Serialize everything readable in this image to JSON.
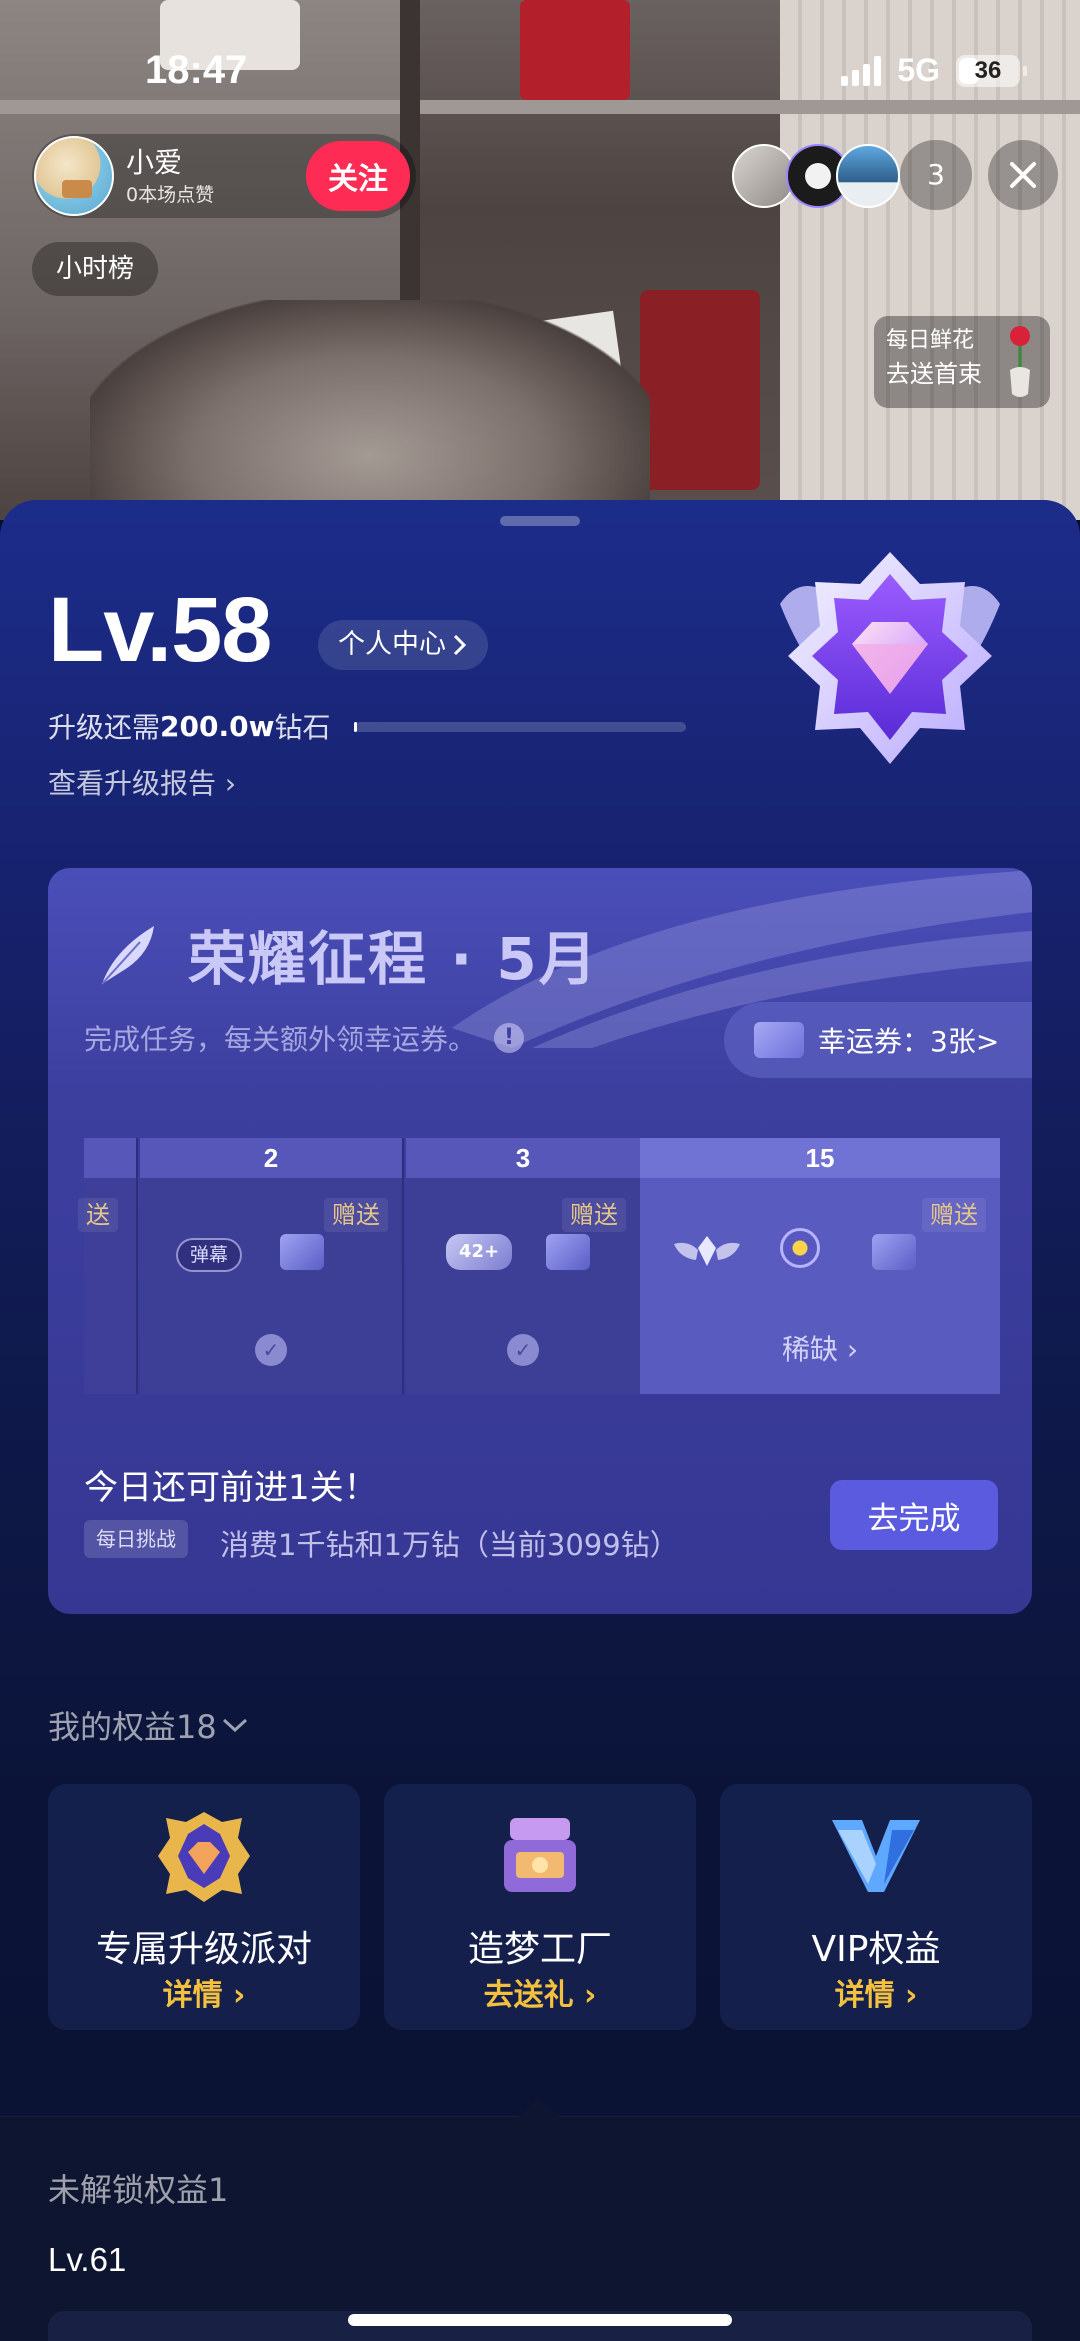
{
  "status": {
    "time": "18:47",
    "network": "5G",
    "battery": "36",
    "battery_level": 0.36
  },
  "host": {
    "name": "小爱",
    "likes": "0本场点赞",
    "follow_label": "关注"
  },
  "hour_rank": "小时榜",
  "viewer_count": "3",
  "flower": {
    "line1": "每日鲜花",
    "line2": "去送首束"
  },
  "level": {
    "label": "Lv.58",
    "personal_center": "个人中心",
    "upgrade_prefix": "升级还需",
    "upgrade_amount": "200.0w",
    "upgrade_suffix": "钻石",
    "progress": 0.01,
    "report_link": "查看升级报告"
  },
  "honor": {
    "title": "荣耀征程 · 5月",
    "subtitle": "完成任务，每关额外领幸运券。",
    "ticket_label": "幸运券：3张>",
    "levels": [
      {
        "num": "",
        "gift": "送",
        "checked": false
      },
      {
        "num": "2",
        "gift": "赠送",
        "chip": "弹幕",
        "checked": true
      },
      {
        "num": "3",
        "gift": "赠送",
        "crown": "42+",
        "checked": true
      },
      {
        "num": "15",
        "gift": "赠送",
        "rare": "稀缺"
      }
    ],
    "today": "今日还可前进1关！",
    "daily_tag": "每日挑战",
    "daily_desc": "消费1千钻和1万钻（当前3099钻）",
    "go_label": "去完成"
  },
  "rights": {
    "title": "我的权益18",
    "items": [
      {
        "name": "专属升级派对",
        "link": "详情"
      },
      {
        "name": "造梦工厂",
        "link": "去送礼"
      },
      {
        "name": "VIP权益",
        "link": "详情"
      }
    ]
  },
  "locked": {
    "title": "未解锁权益1",
    "level": "Lv.61"
  }
}
